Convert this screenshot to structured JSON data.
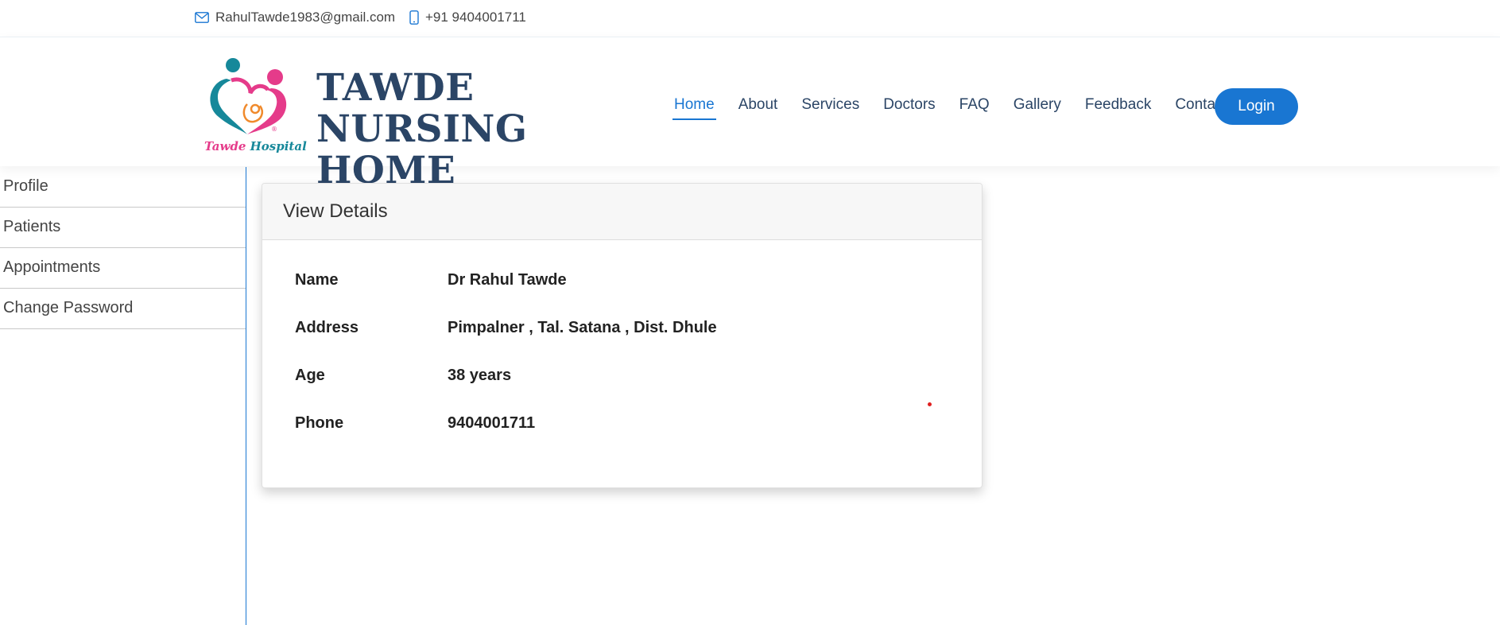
{
  "topbar": {
    "email": "RahulTawde1983@gmail.com",
    "phone": "+91 9404001711"
  },
  "header": {
    "brand_line1": "TAWDE NURSING",
    "brand_line2": "HOME",
    "logo_caption_a": "Tawde ",
    "logo_caption_b": "Hospital"
  },
  "nav": {
    "items": [
      "Home",
      "About",
      "Services",
      "Doctors",
      "FAQ",
      "Gallery",
      "Feedback",
      "Contact"
    ],
    "active": "Home",
    "login_label": "Login"
  },
  "sidebar": {
    "items": [
      "Profile",
      "Patients",
      "Appointments",
      "Change Password"
    ]
  },
  "card": {
    "title": "View Details",
    "rows": [
      {
        "label": "Name",
        "value": "Dr Rahul Tawde"
      },
      {
        "label": "Address",
        "value": "Pimpalner , Tal. Satana , Dist. Dhule"
      },
      {
        "label": "Age",
        "value": "38 years"
      },
      {
        "label": "Phone",
        "value": "9404001711"
      }
    ]
  },
  "colors": {
    "accent": "#1976d2",
    "brand_text": "#2b4566",
    "logo_teal": "#16889a",
    "logo_pink": "#e53b8a",
    "logo_orange": "#f08a2c"
  },
  "icons": {
    "email": "envelope-icon",
    "phone": "mobile-phone-icon"
  }
}
